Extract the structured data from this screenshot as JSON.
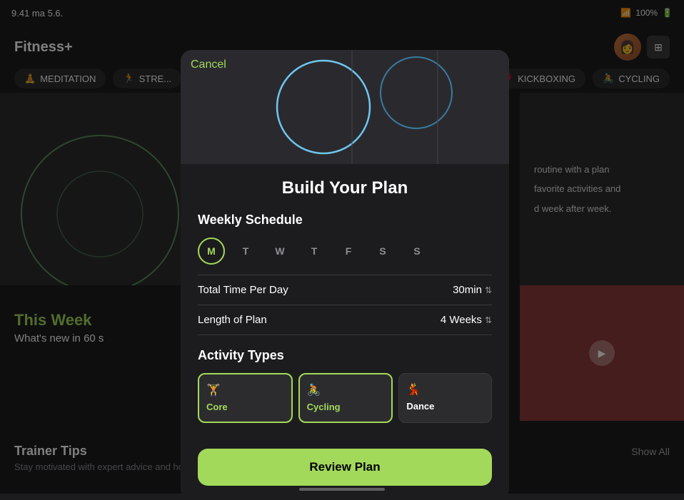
{
  "statusBar": {
    "time": "9.41  ma 5.6.",
    "battery": "100%",
    "wifi": "wifi"
  },
  "header": {
    "logo": "Fitness+",
    "apple_symbol": ""
  },
  "filterTabs": {
    "items": [
      {
        "label": "MEDITATION",
        "icon": "🧘"
      },
      {
        "label": "STRE...",
        "icon": "🏃"
      }
    ],
    "rightItems": [
      {
        "label": "KICKBOXING",
        "icon": "🥊"
      },
      {
        "label": "CYCLING",
        "icon": "🚴"
      }
    ]
  },
  "background": {
    "sidePanel": {
      "lines": [
        "routine with a plan",
        "favorite activities and",
        "d week after week."
      ]
    },
    "thisWeek": {
      "title": "This Week",
      "subtitle": "What's new in 60 s"
    },
    "trainerTips": {
      "title": "Trainer Tips",
      "showAll": "Show All",
      "description": "Stay motivated with expert advice and how-to demos from the Fitness+ trainer team"
    }
  },
  "modal": {
    "cancelLabel": "Cancel",
    "title": "Build Your Plan",
    "weeklySchedule": {
      "sectionTitle": "Weekly Schedule",
      "days": [
        {
          "label": "M",
          "active": true
        },
        {
          "label": "T",
          "active": false
        },
        {
          "label": "W",
          "active": false
        },
        {
          "label": "T",
          "active": false
        },
        {
          "label": "F",
          "active": false
        },
        {
          "label": "S",
          "active": false
        },
        {
          "label": "S",
          "active": false
        }
      ],
      "totalTimePerDay": {
        "label": "Total Time Per Day",
        "value": "30min"
      },
      "lengthOfPlan": {
        "label": "Length of Plan",
        "value": "4 Weeks"
      }
    },
    "activityTypes": {
      "sectionTitle": "Activity Types",
      "items": [
        {
          "label": "Core",
          "icon": "🏋",
          "selected": true
        },
        {
          "label": "Cycling",
          "icon": "🚴",
          "selected": true
        },
        {
          "label": "Dance",
          "icon": "💃",
          "selected": false
        }
      ]
    },
    "reviewButton": "Review Plan"
  }
}
